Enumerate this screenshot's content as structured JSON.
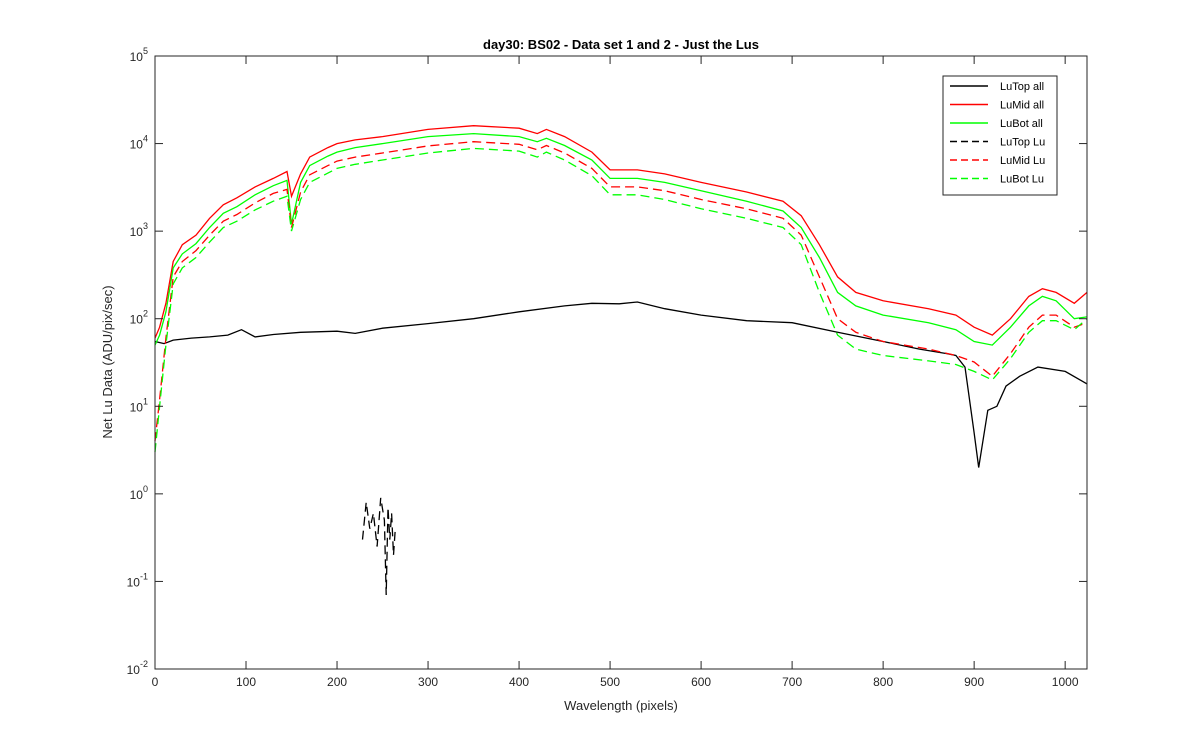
{
  "chart_data": {
    "type": "line",
    "title": "day30: BS02 - Data set 1 and 2 - Just the Lus",
    "xlabel": "Wavelength (pixels)",
    "ylabel": "Net Lu Data (ADU/pix/sec)",
    "xlim": [
      0,
      1024
    ],
    "ylim": [
      0.01,
      100000
    ],
    "yscale": "log",
    "x_ticks": [
      0,
      100,
      200,
      300,
      400,
      500,
      600,
      700,
      800,
      900,
      1000
    ],
    "y_ticks": [
      {
        "value": 0.01,
        "base": "10",
        "exp": "-2"
      },
      {
        "value": 0.1,
        "base": "10",
        "exp": "-1"
      },
      {
        "value": 1,
        "base": "10",
        "exp": "0"
      },
      {
        "value": 10,
        "base": "10",
        "exp": "1"
      },
      {
        "value": 100,
        "base": "10",
        "exp": "2"
      },
      {
        "value": 1000,
        "base": "10",
        "exp": "3"
      },
      {
        "value": 10000,
        "base": "10",
        "exp": "4"
      },
      {
        "value": 100000,
        "base": "10",
        "exp": "5"
      }
    ],
    "grid": false,
    "legend_position": "top-right",
    "series": [
      {
        "name": "LuTop  all",
        "color": "#000000",
        "dash": "solid",
        "x": [
          0,
          10,
          20,
          40,
          60,
          80,
          95,
          110,
          130,
          160,
          200,
          220,
          250,
          300,
          350,
          400,
          450,
          480,
          510,
          530,
          560,
          600,
          650,
          700,
          750,
          800,
          840,
          870,
          880,
          890,
          900,
          905,
          915,
          925,
          935,
          950,
          970,
          1000,
          1024
        ],
        "y": [
          55,
          52,
          57,
          60,
          62,
          65,
          75,
          62,
          66,
          70,
          72,
          68,
          78,
          88,
          100,
          120,
          140,
          150,
          148,
          155,
          130,
          110,
          95,
          90,
          70,
          55,
          45,
          40,
          38,
          28,
          5,
          2,
          9,
          10,
          17,
          22,
          28,
          25,
          18
        ]
      },
      {
        "name": "LuMid  all",
        "color": "#ff0000",
        "dash": "solid",
        "x": [
          0,
          5,
          12,
          20,
          30,
          45,
          60,
          75,
          90,
          110,
          130,
          145,
          150,
          160,
          170,
          190,
          200,
          220,
          250,
          300,
          350,
          400,
          420,
          430,
          450,
          480,
          500,
          530,
          560,
          600,
          650,
          690,
          710,
          730,
          750,
          770,
          800,
          850,
          880,
          900,
          920,
          940,
          960,
          975,
          990,
          1010,
          1024
        ],
        "y": [
          60,
          80,
          150,
          450,
          700,
          900,
          1400,
          2000,
          2400,
          3200,
          4000,
          4800,
          2500,
          4500,
          7000,
          9000,
          10000,
          11000,
          12000,
          14500,
          16000,
          15000,
          13000,
          14500,
          12000,
          8000,
          5000,
          5000,
          4500,
          3600,
          2800,
          2200,
          1500,
          700,
          300,
          200,
          160,
          130,
          110,
          80,
          65,
          100,
          180,
          220,
          200,
          150,
          200
        ]
      },
      {
        "name": "LuBot  all",
        "color": "#00ff00",
        "dash": "solid",
        "x": [
          0,
          5,
          12,
          20,
          30,
          45,
          60,
          75,
          90,
          110,
          130,
          145,
          150,
          160,
          170,
          190,
          200,
          220,
          250,
          300,
          350,
          400,
          420,
          430,
          450,
          480,
          500,
          530,
          560,
          600,
          650,
          690,
          710,
          730,
          750,
          770,
          800,
          850,
          880,
          900,
          920,
          940,
          960,
          975,
          990,
          1010,
          1024
        ],
        "y": [
          50,
          65,
          120,
          380,
          550,
          720,
          1100,
          1600,
          1900,
          2600,
          3300,
          3800,
          1200,
          3600,
          5600,
          7200,
          8000,
          9000,
          10000,
          12000,
          13000,
          12000,
          10500,
          11500,
          9500,
          6500,
          4000,
          4000,
          3600,
          2900,
          2200,
          1700,
          1100,
          500,
          200,
          140,
          110,
          90,
          75,
          55,
          50,
          80,
          140,
          180,
          160,
          100,
          105
        ]
      },
      {
        "name": "LuTop  Lu",
        "color": "#000000",
        "dash": "dashed",
        "x": [
          228,
          232,
          236,
          240,
          244,
          248,
          252,
          254,
          256,
          258,
          260,
          262,
          264
        ],
        "y": [
          0.3,
          0.8,
          0.4,
          0.6,
          0.25,
          0.9,
          0.5,
          0.07,
          0.7,
          0.3,
          0.6,
          0.2,
          0.4
        ]
      },
      {
        "name": "LuMid  Lu",
        "color": "#ff0000",
        "dash": "dashed",
        "x": [
          0,
          5,
          12,
          20,
          30,
          45,
          60,
          75,
          90,
          110,
          130,
          145,
          150,
          160,
          170,
          190,
          200,
          220,
          250,
          300,
          350,
          400,
          420,
          430,
          450,
          480,
          500,
          530,
          560,
          600,
          650,
          690,
          710,
          730,
          750,
          770,
          800,
          850,
          880,
          900,
          920,
          940,
          960,
          975,
          990,
          1010,
          1024
        ],
        "y": [
          4,
          12,
          60,
          300,
          450,
          600,
          900,
          1300,
          1550,
          2100,
          2700,
          3000,
          1100,
          2800,
          4400,
          5600,
          6300,
          7000,
          7800,
          9400,
          10500,
          9800,
          8500,
          9500,
          7800,
          5200,
          3200,
          3200,
          2900,
          2300,
          1800,
          1400,
          900,
          300,
          100,
          70,
          55,
          45,
          38,
          32,
          22,
          40,
          80,
          110,
          110,
          80,
          90
        ]
      },
      {
        "name": "LuBot  Lu",
        "color": "#00ff00",
        "dash": "dashed",
        "x": [
          0,
          5,
          12,
          20,
          30,
          45,
          60,
          75,
          90,
          110,
          130,
          145,
          150,
          160,
          170,
          190,
          200,
          220,
          250,
          300,
          350,
          400,
          420,
          430,
          450,
          480,
          500,
          530,
          560,
          600,
          650,
          690,
          710,
          730,
          750,
          770,
          800,
          850,
          880,
          900,
          920,
          940,
          960,
          975,
          990,
          1010,
          1024
        ],
        "y": [
          3,
          10,
          50,
          250,
          380,
          500,
          750,
          1100,
          1300,
          1750,
          2200,
          2500,
          1000,
          2300,
          3600,
          4600,
          5200,
          5800,
          6500,
          7800,
          8800,
          8200,
          7000,
          8000,
          6500,
          4300,
          2600,
          2600,
          2300,
          1800,
          1400,
          1100,
          700,
          200,
          65,
          45,
          38,
          33,
          30,
          25,
          20,
          35,
          70,
          95,
          95,
          75,
          100
        ]
      }
    ]
  }
}
